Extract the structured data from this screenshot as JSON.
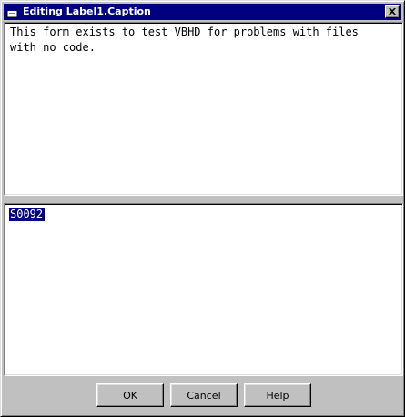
{
  "window": {
    "title": "Editing Label1.Caption",
    "title_color": "#000080"
  },
  "caption_editor": {
    "text": "This form exists to test VBHD for problems with files\nwith no code."
  },
  "value_editor": {
    "selected_text": "S0092",
    "selection_color": "#000080"
  },
  "buttons": {
    "ok_label": "OK",
    "cancel_label": "Cancel",
    "help_label": "Help"
  },
  "icons": {
    "app": "app-window-icon",
    "close": "close-icon"
  }
}
